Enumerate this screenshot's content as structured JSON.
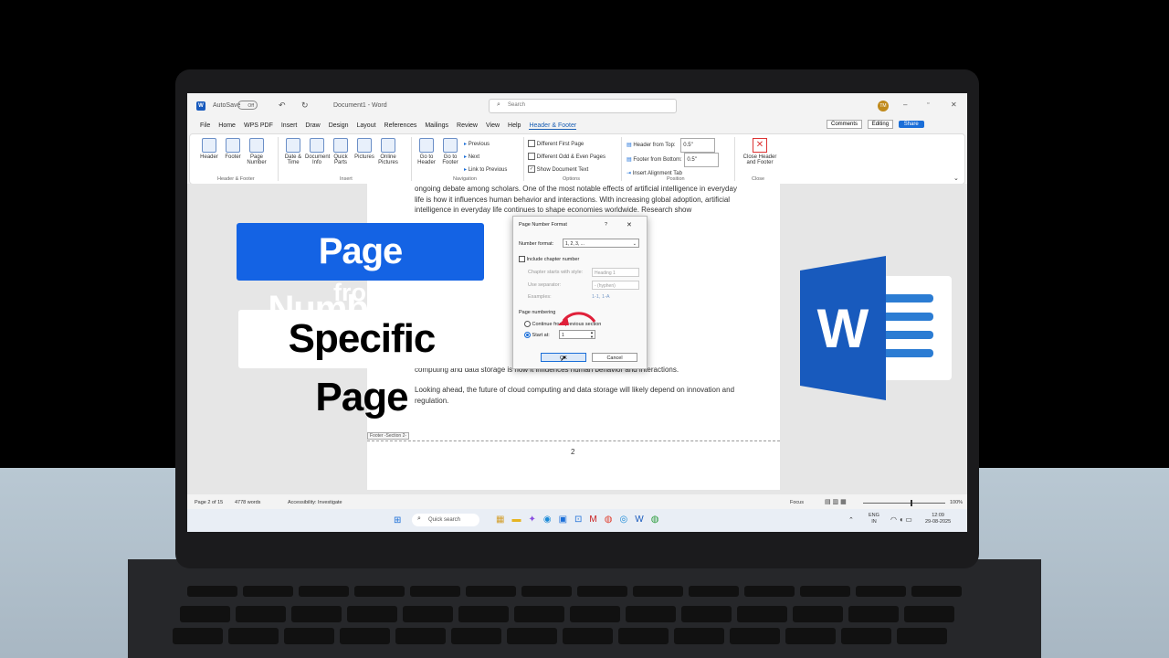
{
  "overlay": {
    "line1": "Page Numbering",
    "line2": "from",
    "line3": "Specific Page"
  },
  "word": {
    "titlebar": {
      "autosave": "AutoSave",
      "toggle": "Off",
      "doc_title": "Document1 - Word",
      "search_placeholder": "Search",
      "user_initials": "TM"
    },
    "menu": [
      "File",
      "Home",
      "WPS PDF",
      "Insert",
      "Draw",
      "Design",
      "Layout",
      "References",
      "Mailings",
      "Review",
      "View",
      "Help",
      "Header & Footer"
    ],
    "right_buttons": {
      "comments": "Comments",
      "editing": "Editing",
      "share": "Share"
    },
    "ribbon": {
      "hf_group": {
        "label": "Header & Footer",
        "items": [
          "Header",
          "Footer",
          "Page Number"
        ]
      },
      "insert_group": {
        "label": "Insert",
        "items": [
          "Date & Time",
          "Document Info",
          "Quick Parts",
          "Pictures",
          "Online Pictures"
        ]
      },
      "nav_group": {
        "label": "Navigation",
        "items": [
          "Go to Header",
          "Go to Footer"
        ],
        "small": [
          "Previous",
          "Next",
          "Link to Previous"
        ]
      },
      "options_group": {
        "label": "Options",
        "checks": [
          "Different First Page",
          "Different Odd & Even Pages",
          "Show Document Text"
        ]
      },
      "position_group": {
        "label": "Position",
        "header_top_label": "Header from Top:",
        "header_top_value": "0.5\"",
        "footer_bottom_label": "Footer from Bottom:",
        "footer_bottom_value": "0.5\"",
        "align_tab": "Insert Alignment Tab"
      },
      "close_group": {
        "label": "Close",
        "button": "Close Header and Footer"
      }
    },
    "doc_text_top": "ongoing debate among scholars. One of the most notable effects of artificial intelligence in everyday life is how it influences human behavior and interactions. With increasing global adoption, artificial intelligence in everyday life continues to shape economies worldwide. Research show",
    "doc_text_bottom": "Looking ahead, the future of cloud computing and data storage will likely depend on innovation and regulation.",
    "doc_text_mid2": "computing and data storage is how it influences human behavior and interactions.",
    "footer_label": "Footer -Section 2-",
    "footer_page_num": "2",
    "status": {
      "page": "Page 2 of 15",
      "words": "4778 words",
      "accessibility": "Accessibility: Investigate",
      "focus": "Focus",
      "zoom": "100%"
    },
    "taskbar": {
      "search": "Quick search",
      "lang": "ENG",
      "region": "IN",
      "time": "12:09",
      "date": "29-08-2025"
    }
  },
  "dialog": {
    "title": "Page Number Format",
    "help": "?",
    "close": "✕",
    "number_format_label": "Number format:",
    "number_format_value": "1, 2, 3, ...",
    "include_chapter": "Include chapter number",
    "chapter_style_label": "Chapter starts with style:",
    "chapter_style_value": "Heading 1",
    "separator_label": "Use separator:",
    "separator_value": "-   (hyphen)",
    "examples_label": "Examples:",
    "examples_value": "1-1, 1-A",
    "page_numbering_label": "Page numbering",
    "continue_label": "Continue from previous section",
    "start_at_label": "Start at:",
    "start_at_value": "1",
    "ok": "OK",
    "cancel": "Cancel"
  },
  "colors": {
    "accent": "#1463e4",
    "word_blue": "#185abd",
    "arrow": "#e0203a"
  }
}
